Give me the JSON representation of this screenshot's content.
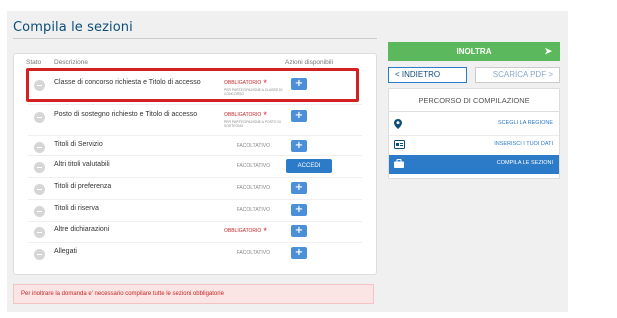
{
  "page": {
    "title": "Compila le sezioni"
  },
  "table": {
    "col_stato": "Stato",
    "col_descrizione": "Descrizione",
    "col_azioni": "Azioni disponibili",
    "rows": [
      {
        "description": "Classe di concorso richiesta e Titolo di accesso",
        "status": "OBBLIGATORIO",
        "note": "PER PARTECIPAZIONE A CLASSE DI CONCORSO",
        "required": true,
        "action": "+"
      },
      {
        "description": "Posto di sostegno richiesto e Titolo di accesso",
        "status": "OBBLIGATORIO",
        "note": "PER PARTECIPAZIONE A POSTO DI SOSTEGNO",
        "required": true,
        "action": "+"
      },
      {
        "description": "Titoli di Servizio",
        "status": "FACOLTATIVO",
        "required": false,
        "action": "+"
      },
      {
        "description": "Altri titoli valutabili",
        "status": "FACOLTATIVO",
        "required": false,
        "action": "ACCEDI"
      },
      {
        "description": "Titoli di preferenza",
        "status": "FACOLTATIVO",
        "required": false,
        "action": "+"
      },
      {
        "description": "Titoli di riserva",
        "status": "FACOLTATIVO",
        "required": false,
        "action": "+"
      },
      {
        "description": "Altre dichiarazioni",
        "status": "OBBLIGATORIO",
        "required": true,
        "action": "+"
      },
      {
        "description": "Allegati",
        "status": "FACOLTATIVO",
        "required": false,
        "action": "+"
      }
    ],
    "required_star": "*"
  },
  "warning": "Per inoltrare la domanda e' necessario compilare tutte le sezioni obbligatorie",
  "sidebar": {
    "send_label": "INOLTRA",
    "send_icon": "paper-plane-icon",
    "back_label": "< INDIETRO",
    "pdf_label": "SCARICA PDF >",
    "route_title": "PERCORSO DI COMPILAZIONE",
    "steps": [
      {
        "label": "SCEGLI LA REGIONE",
        "icon": "map-marker-icon",
        "active": false
      },
      {
        "label": "INSERISCI I TUOI DATI",
        "icon": "id-card-icon",
        "active": false
      },
      {
        "label": "COMPILA LE SEZIONI",
        "icon": "briefcase-icon",
        "active": true
      }
    ]
  },
  "colors": {
    "primary": "#2b7bc9",
    "success": "#5cb85c",
    "required": "#c62828",
    "title": "#0b4d77"
  }
}
